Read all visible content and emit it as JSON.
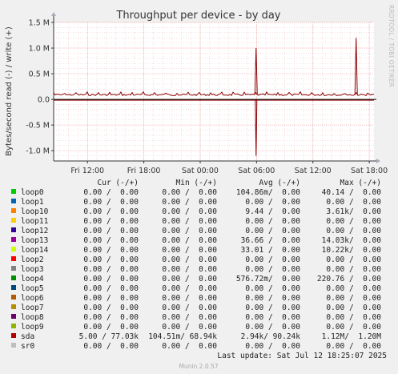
{
  "chart_data": {
    "type": "line",
    "title": "Throughput per device - by day",
    "ylabel": "Bytes/second read (-) / write (+)",
    "ylim": [
      -1200000,
      1500000
    ],
    "y_ticks": [
      {
        "value": 1500000,
        "label": "1.5 M"
      },
      {
        "value": 1000000,
        "label": "1.0 M"
      },
      {
        "value": 500000,
        "label": "0.5 M"
      },
      {
        "value": 0,
        "label": "0.0"
      },
      {
        "value": -500000,
        "label": "-0.5 M"
      },
      {
        "value": -1000000,
        "label": "-1.0 M"
      }
    ],
    "x_ticks": [
      "Fri 12:00",
      "Fri 18:00",
      "Sat 00:00",
      "Sat 06:00",
      "Sat 12:00",
      "Sat 18:00"
    ],
    "x_hours": {
      "range": [
        8.4,
        42.5
      ],
      "tick_positions": [
        12,
        18,
        24,
        30,
        36,
        42
      ]
    },
    "series": [
      {
        "name": "sda",
        "color": "#8c0000",
        "write_baseline": 90000,
        "read_baseline": 0,
        "write_spikes": [
          {
            "hour": 29.95,
            "value": 1000000
          },
          {
            "hour": 40.6,
            "value": 1200000
          }
        ],
        "read_spikes": [
          {
            "hour": 29.95,
            "value": -1100000
          }
        ]
      }
    ],
    "grid": true,
    "watermark": "RRDTOOL / TOBI OETIKER"
  },
  "legend": {
    "headers": [
      "Cur (-/+)",
      "Min (-/+)",
      "Avg (-/+)",
      "Max (-/+)"
    ],
    "rows": [
      {
        "name": "loop0",
        "color": "#00cc00",
        "cur": "0.00 /  0.00",
        "min": "0.00 /  0.00",
        "avg": "104.86m/  0.00",
        "max": "40.14 /  0.00"
      },
      {
        "name": "loop1",
        "color": "#0066b3",
        "cur": "0.00 /  0.00",
        "min": "0.00 /  0.00",
        "avg": "0.00 /  0.00",
        "max": "0.00 /  0.00"
      },
      {
        "name": "loop10",
        "color": "#ff8000",
        "cur": "0.00 /  0.00",
        "min": "0.00 /  0.00",
        "avg": "9.44 /  0.00",
        "max": "3.61k/  0.00"
      },
      {
        "name": "loop11",
        "color": "#ffcc00",
        "cur": "0.00 /  0.00",
        "min": "0.00 /  0.00",
        "avg": "0.00 /  0.00",
        "max": "0.00 /  0.00"
      },
      {
        "name": "loop12",
        "color": "#330099",
        "cur": "0.00 /  0.00",
        "min": "0.00 /  0.00",
        "avg": "0.00 /  0.00",
        "max": "0.00 /  0.00"
      },
      {
        "name": "loop13",
        "color": "#990099",
        "cur": "0.00 /  0.00",
        "min": "0.00 /  0.00",
        "avg": "36.66 /  0.00",
        "max": "14.03k/  0.00"
      },
      {
        "name": "loop14",
        "color": "#ccff00",
        "cur": "0.00 /  0.00",
        "min": "0.00 /  0.00",
        "avg": "33.01 /  0.00",
        "max": "10.22k/  0.00"
      },
      {
        "name": "loop2",
        "color": "#ff0000",
        "cur": "0.00 /  0.00",
        "min": "0.00 /  0.00",
        "avg": "0.00 /  0.00",
        "max": "0.00 /  0.00"
      },
      {
        "name": "loop3",
        "color": "#808080",
        "cur": "0.00 /  0.00",
        "min": "0.00 /  0.00",
        "avg": "0.00 /  0.00",
        "max": "0.00 /  0.00"
      },
      {
        "name": "loop4",
        "color": "#008f00",
        "cur": "0.00 /  0.00",
        "min": "0.00 /  0.00",
        "avg": "576.72m/  0.00",
        "max": "220.76 /  0.00"
      },
      {
        "name": "loop5",
        "color": "#00487d",
        "cur": "0.00 /  0.00",
        "min": "0.00 /  0.00",
        "avg": "0.00 /  0.00",
        "max": "0.00 /  0.00"
      },
      {
        "name": "loop6",
        "color": "#b35a00",
        "cur": "0.00 /  0.00",
        "min": "0.00 /  0.00",
        "avg": "0.00 /  0.00",
        "max": "0.00 /  0.00"
      },
      {
        "name": "loop7",
        "color": "#b38f00",
        "cur": "0.00 /  0.00",
        "min": "0.00 /  0.00",
        "avg": "0.00 /  0.00",
        "max": "0.00 /  0.00"
      },
      {
        "name": "loop8",
        "color": "#6b006b",
        "cur": "0.00 /  0.00",
        "min": "0.00 /  0.00",
        "avg": "0.00 /  0.00",
        "max": "0.00 /  0.00"
      },
      {
        "name": "loop9",
        "color": "#8fb300",
        "cur": "0.00 /  0.00",
        "min": "0.00 /  0.00",
        "avg": "0.00 /  0.00",
        "max": "0.00 /  0.00"
      },
      {
        "name": "sda",
        "color": "#b30000",
        "cur": "5.00 / 77.03k",
        "min": "104.51m/ 68.94k",
        "avg": "2.94k/ 90.24k",
        "max": "1.12M/  1.20M"
      },
      {
        "name": "sr0",
        "color": "#bebebe",
        "cur": "0.00 /  0.00",
        "min": "0.00 /  0.00",
        "avg": "0.00 /  0.00",
        "max": "0.00 /  0.00"
      }
    ]
  },
  "footer": {
    "last_update": "Last update: Sat Jul 12 18:25:07 2025",
    "version": "Munin 2.0.57"
  }
}
